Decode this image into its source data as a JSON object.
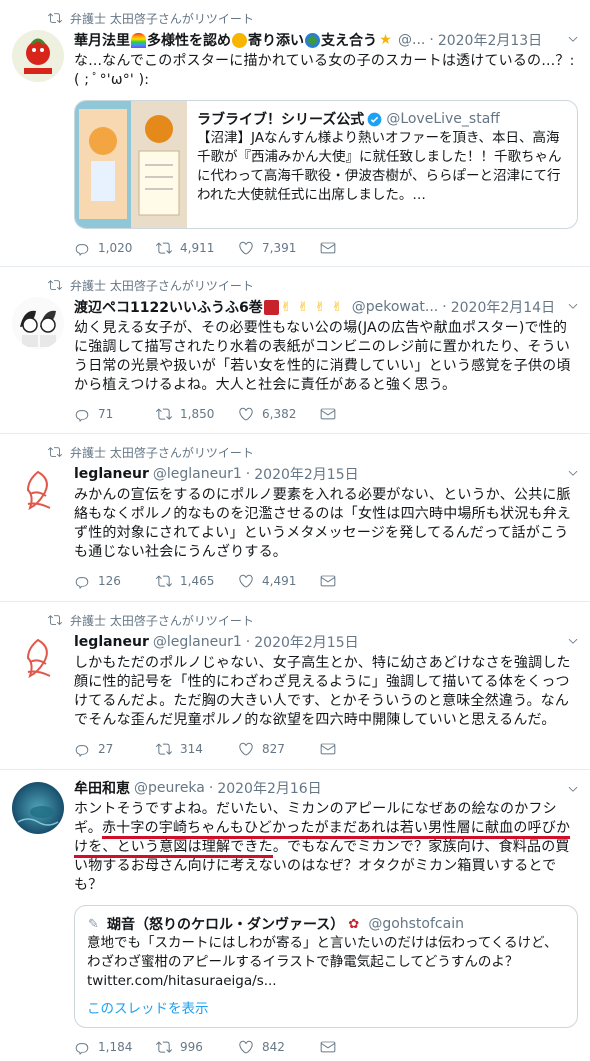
{
  "tweets": [
    {
      "retweet_label": "弁護士 太田啓子さんがリツイート",
      "name": "華月法里",
      "name_emoji_suffix": "多様性を認め",
      "name_suffix2": "寄り添い",
      "name_suffix3": "支え合う",
      "handle": "@...",
      "date": "2020年2月13日",
      "text": "な...なんでこのポスターに描かれている女の子のスカートは透けているの…？:( ; ﾟ°'ω°' ):",
      "quote": {
        "name": "ラブライブ！シリーズ公式",
        "handle": "@LoveLive_staff",
        "text": "【沼津】JAなんすん様より熱いオファーを頂き、本日、高海千歌が『西浦みかん大使』に就任致しました！！千歌ちゃんに代わって高海千歌役・伊波杏樹が、ららぽーと沼津にて行われた大使就任式に出席しました。…"
      },
      "replies": "1,020",
      "retweets": "4,911",
      "likes": "7,391"
    },
    {
      "retweet_label": "弁護士 太田啓子さんがリツイート",
      "name": "渡辺ペコ1122いいふうふ6巻",
      "handle": "@pekowat...",
      "date": "2020年2月14日",
      "text": "幼く見える女子が、その必要性もない公の場(JAの広告や献血ポスター)で性的に強調して描写されたり水着の表紙がコンビニのレジ前に置かれたり、そういう日常の光景や扱いが「若い女を性的に消費していい」という感覚を子供の頃から植えつけるよね。大人と社会に責任があると強く思う。",
      "replies": "71",
      "retweets": "1,850",
      "likes": "6,382"
    },
    {
      "retweet_label": "弁護士 太田啓子さんがリツイート",
      "name": "leglaneur",
      "handle": "@leglaneur1",
      "date": "2020年2月15日",
      "text": "みかんの宣伝をするのにポルノ要素を入れる必要がない、というか、公共に脈絡もなくポルノ的なものを氾濫させるのは「女性は四六時中場所も状況も弁えず性的対象にされてよい」というメタメッセージを発してるんだって話がこうも通じない社会にうんざりする。",
      "replies": "126",
      "retweets": "1,465",
      "likes": "4,491"
    },
    {
      "retweet_label": "弁護士 太田啓子さんがリツイート",
      "name": "leglaneur",
      "handle": "@leglaneur1",
      "date": "2020年2月15日",
      "text": "しかもただのポルノじゃない、女子高生とか、特に幼さあどけなさを強調した顔に性的記号を「性的にわざわざ見えるように」強調して描いてる体をくっつけてるんだよ。ただ胸の大きい人です、とかそういうのと意味全然違う。なんでそんな歪んだ児童ポルノ的な欲望を四六時中開陳していいと思えるんだ。",
      "replies": "27",
      "retweets": "314",
      "likes": "827"
    },
    {
      "name": "牟田和恵",
      "handle": "@peureka",
      "date": "2020年2月16日",
      "text_a": "ホントそうですよね。だいたい、ミカンのアピールになぜあの絵なのかフシギ。",
      "text_underlined": "赤十字の宇崎ちゃんもひどかったがまだあれは若い男性層に献血の呼びかけを、という意図は理解できた",
      "text_b": "。でもなんでミカンで？家族向け、食料品の買い物するお母さん向けに考えないのはなぜ？オタクがミカン箱買いするとでも？",
      "quote": {
        "name": "瑚音（怒りのケロル・ダンヴァース）",
        "handle": "@gohstofcain",
        "text": "意地でも「スカートにはしわが寄る」と言いたいのだけは伝わってくるけど、わざわざ蜜柑のアピールするイラストで静電気起こしてどうすんのよ？",
        "link": "twitter.com/hitasuraeiga/s...",
        "show_thread": "このスレッドを表示"
      },
      "replies": "1,184",
      "retweets": "996",
      "likes": "842"
    }
  ]
}
